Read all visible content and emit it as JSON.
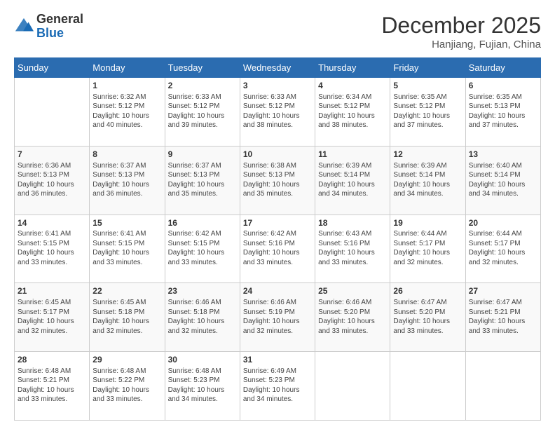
{
  "logo": {
    "general": "General",
    "blue": "Blue"
  },
  "header": {
    "month_year": "December 2025",
    "location": "Hanjiang, Fujian, China"
  },
  "weekdays": [
    "Sunday",
    "Monday",
    "Tuesday",
    "Wednesday",
    "Thursday",
    "Friday",
    "Saturday"
  ],
  "weeks": [
    [
      {
        "day": "",
        "info": ""
      },
      {
        "day": "1",
        "info": "Sunrise: 6:32 AM\nSunset: 5:12 PM\nDaylight: 10 hours\nand 40 minutes."
      },
      {
        "day": "2",
        "info": "Sunrise: 6:33 AM\nSunset: 5:12 PM\nDaylight: 10 hours\nand 39 minutes."
      },
      {
        "day": "3",
        "info": "Sunrise: 6:33 AM\nSunset: 5:12 PM\nDaylight: 10 hours\nand 38 minutes."
      },
      {
        "day": "4",
        "info": "Sunrise: 6:34 AM\nSunset: 5:12 PM\nDaylight: 10 hours\nand 38 minutes."
      },
      {
        "day": "5",
        "info": "Sunrise: 6:35 AM\nSunset: 5:12 PM\nDaylight: 10 hours\nand 37 minutes."
      },
      {
        "day": "6",
        "info": "Sunrise: 6:35 AM\nSunset: 5:13 PM\nDaylight: 10 hours\nand 37 minutes."
      }
    ],
    [
      {
        "day": "7",
        "info": "Sunrise: 6:36 AM\nSunset: 5:13 PM\nDaylight: 10 hours\nand 36 minutes."
      },
      {
        "day": "8",
        "info": "Sunrise: 6:37 AM\nSunset: 5:13 PM\nDaylight: 10 hours\nand 36 minutes."
      },
      {
        "day": "9",
        "info": "Sunrise: 6:37 AM\nSunset: 5:13 PM\nDaylight: 10 hours\nand 35 minutes."
      },
      {
        "day": "10",
        "info": "Sunrise: 6:38 AM\nSunset: 5:13 PM\nDaylight: 10 hours\nand 35 minutes."
      },
      {
        "day": "11",
        "info": "Sunrise: 6:39 AM\nSunset: 5:14 PM\nDaylight: 10 hours\nand 34 minutes."
      },
      {
        "day": "12",
        "info": "Sunrise: 6:39 AM\nSunset: 5:14 PM\nDaylight: 10 hours\nand 34 minutes."
      },
      {
        "day": "13",
        "info": "Sunrise: 6:40 AM\nSunset: 5:14 PM\nDaylight: 10 hours\nand 34 minutes."
      }
    ],
    [
      {
        "day": "14",
        "info": "Sunrise: 6:41 AM\nSunset: 5:15 PM\nDaylight: 10 hours\nand 33 minutes."
      },
      {
        "day": "15",
        "info": "Sunrise: 6:41 AM\nSunset: 5:15 PM\nDaylight: 10 hours\nand 33 minutes."
      },
      {
        "day": "16",
        "info": "Sunrise: 6:42 AM\nSunset: 5:15 PM\nDaylight: 10 hours\nand 33 minutes."
      },
      {
        "day": "17",
        "info": "Sunrise: 6:42 AM\nSunset: 5:16 PM\nDaylight: 10 hours\nand 33 minutes."
      },
      {
        "day": "18",
        "info": "Sunrise: 6:43 AM\nSunset: 5:16 PM\nDaylight: 10 hours\nand 33 minutes."
      },
      {
        "day": "19",
        "info": "Sunrise: 6:44 AM\nSunset: 5:17 PM\nDaylight: 10 hours\nand 32 minutes."
      },
      {
        "day": "20",
        "info": "Sunrise: 6:44 AM\nSunset: 5:17 PM\nDaylight: 10 hours\nand 32 minutes."
      }
    ],
    [
      {
        "day": "21",
        "info": "Sunrise: 6:45 AM\nSunset: 5:17 PM\nDaylight: 10 hours\nand 32 minutes."
      },
      {
        "day": "22",
        "info": "Sunrise: 6:45 AM\nSunset: 5:18 PM\nDaylight: 10 hours\nand 32 minutes."
      },
      {
        "day": "23",
        "info": "Sunrise: 6:46 AM\nSunset: 5:18 PM\nDaylight: 10 hours\nand 32 minutes."
      },
      {
        "day": "24",
        "info": "Sunrise: 6:46 AM\nSunset: 5:19 PM\nDaylight: 10 hours\nand 32 minutes."
      },
      {
        "day": "25",
        "info": "Sunrise: 6:46 AM\nSunset: 5:20 PM\nDaylight: 10 hours\nand 33 minutes."
      },
      {
        "day": "26",
        "info": "Sunrise: 6:47 AM\nSunset: 5:20 PM\nDaylight: 10 hours\nand 33 minutes."
      },
      {
        "day": "27",
        "info": "Sunrise: 6:47 AM\nSunset: 5:21 PM\nDaylight: 10 hours\nand 33 minutes."
      }
    ],
    [
      {
        "day": "28",
        "info": "Sunrise: 6:48 AM\nSunset: 5:21 PM\nDaylight: 10 hours\nand 33 minutes."
      },
      {
        "day": "29",
        "info": "Sunrise: 6:48 AM\nSunset: 5:22 PM\nDaylight: 10 hours\nand 33 minutes."
      },
      {
        "day": "30",
        "info": "Sunrise: 6:48 AM\nSunset: 5:23 PM\nDaylight: 10 hours\nand 34 minutes."
      },
      {
        "day": "31",
        "info": "Sunrise: 6:49 AM\nSunset: 5:23 PM\nDaylight: 10 hours\nand 34 minutes."
      },
      {
        "day": "",
        "info": ""
      },
      {
        "day": "",
        "info": ""
      },
      {
        "day": "",
        "info": ""
      }
    ]
  ]
}
